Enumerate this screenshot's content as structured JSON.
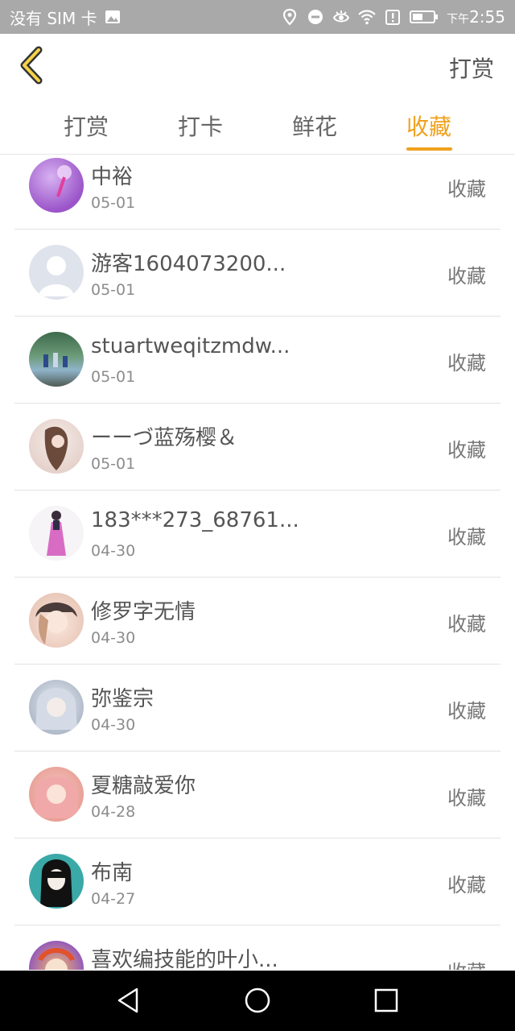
{
  "status_bar": {
    "carrier": "没有 SIM 卡",
    "time_prefix": "下午",
    "time": "2:55",
    "icons": [
      "image-icon",
      "location-icon",
      "do-not-disturb-icon",
      "eye-icon",
      "wifi-icon",
      "alert-icon",
      "battery-icon"
    ]
  },
  "header": {
    "back_icon": "chevron-left-icon",
    "action_label": "打赏"
  },
  "tabs": [
    {
      "label": "打赏",
      "active": false
    },
    {
      "label": "打卡",
      "active": false
    },
    {
      "label": "鲜花",
      "active": false
    },
    {
      "label": "收藏",
      "active": true
    }
  ],
  "colors": {
    "accent": "#f0a11d",
    "status_bar": "#a9a9a9",
    "nav_bar": "#000000"
  },
  "list": [
    {
      "name": "中裕",
      "date": "05-01",
      "action": "收藏"
    },
    {
      "name": "游客1604073200...",
      "date": "05-01",
      "action": "收藏"
    },
    {
      "name": "stuartweqitzmdw...",
      "date": "05-01",
      "action": "收藏"
    },
    {
      "name": "ーーづ蓝殇樱＆",
      "date": "05-01",
      "action": "收藏"
    },
    {
      "name": "183***273_68761...",
      "date": "04-30",
      "action": "收藏"
    },
    {
      "name": "修罗字无情",
      "date": "04-30",
      "action": "收藏"
    },
    {
      "name": "弥鉴宗",
      "date": "04-30",
      "action": "收藏"
    },
    {
      "name": "夏糖敲爱你",
      "date": "04-28",
      "action": "收藏"
    },
    {
      "name": "布南",
      "date": "04-27",
      "action": "收藏"
    },
    {
      "name": "喜欢编技能的叶小...",
      "date": "",
      "action": "收藏"
    }
  ],
  "nav_bar": {
    "icons": [
      "back-triangle-icon",
      "home-circle-icon",
      "recents-square-icon"
    ]
  }
}
